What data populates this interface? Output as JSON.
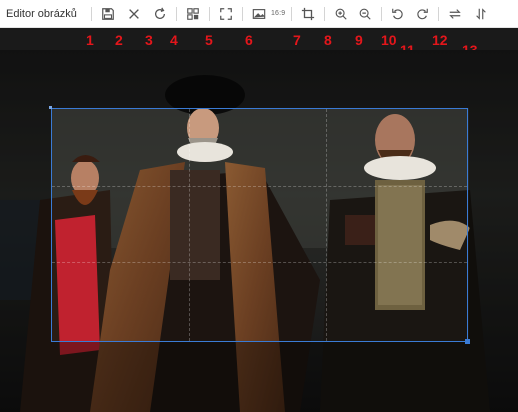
{
  "app": {
    "title": "Editor obrázků"
  },
  "toolbar": {
    "buttons": [
      {
        "name": "save",
        "icon": "save-icon"
      },
      {
        "name": "close",
        "icon": "close-icon"
      },
      {
        "name": "reset",
        "icon": "reset-icon"
      },
      {
        "name": "resize",
        "icon": "resize-icon"
      },
      {
        "name": "fullscreen",
        "icon": "fullscreen-icon"
      },
      {
        "name": "aspect-ratio",
        "icon": "aspect-ratio-icon"
      },
      {
        "name": "crop",
        "icon": "crop-icon"
      },
      {
        "name": "zoom-in",
        "icon": "zoom-in-icon"
      },
      {
        "name": "zoom-out",
        "icon": "zoom-out-icon"
      },
      {
        "name": "rotate-left",
        "icon": "rotate-left-icon"
      },
      {
        "name": "rotate-right",
        "icon": "rotate-right-icon"
      },
      {
        "name": "flip-horizontal",
        "icon": "flip-horizontal-icon"
      },
      {
        "name": "flip-vertical",
        "icon": "flip-vertical-icon"
      }
    ],
    "ratio_text": "16:9"
  },
  "callouts": [
    "1",
    "2",
    "3",
    "4",
    "5",
    "6",
    "7",
    "8",
    "9",
    "10",
    "11",
    "12",
    "13"
  ],
  "colors": {
    "callout": "#e4161b",
    "crop_border": "#3a7bd5",
    "toolbar_bg": "#ffffff"
  }
}
